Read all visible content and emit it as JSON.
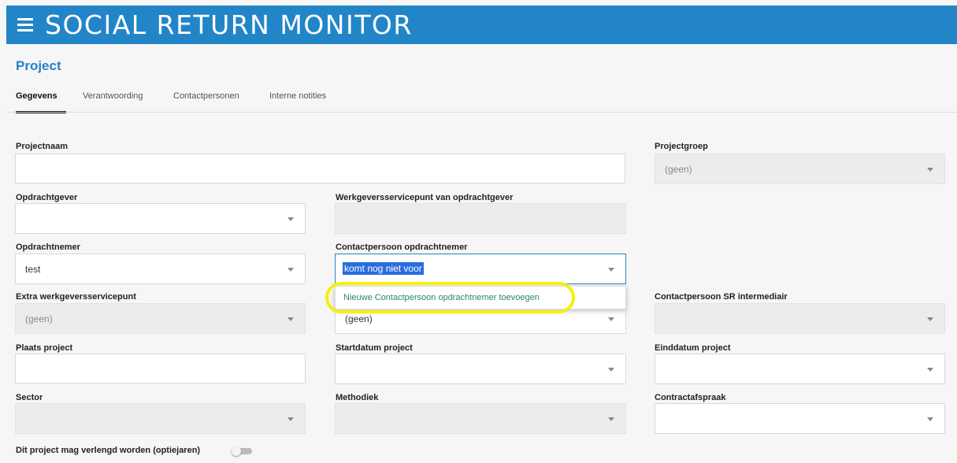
{
  "app": {
    "title": "SOCIAL RETURN MONITOR"
  },
  "page": {
    "title": "Project"
  },
  "tabs": [
    {
      "label": "Gegevens",
      "active": true
    },
    {
      "label": "Verantwoording",
      "active": false
    },
    {
      "label": "Contactpersonen",
      "active": false
    },
    {
      "label": "Interne notities",
      "active": false
    }
  ],
  "form": {
    "projectnaam": {
      "label": "Projectnaam",
      "value": ""
    },
    "projectgroep": {
      "label": "Projectgroep",
      "value": "(geen)"
    },
    "opdrachtgever": {
      "label": "Opdrachtgever",
      "value": ""
    },
    "werkgeversservicepunt_opdrachtgever": {
      "label": "Werkgeversservicepunt van opdrachtgever",
      "value": ""
    },
    "opdrachtnemer": {
      "label": "Opdrachtnemer",
      "value": "test"
    },
    "contactpersoon_opdrachtnemer": {
      "label": "Contactpersoon opdrachtnemer",
      "value": "komt nog niet voor",
      "dropdown_option": "Nieuwe Contactpersoon opdrachtnemer toevoegen"
    },
    "extra_werkgeversservicepunt": {
      "label": "Extra werkgeversservicepunt",
      "value": "(geen)"
    },
    "middle_row4": {
      "value": "(geen)"
    },
    "contactpersoon_sr_intermediair": {
      "label": "Contactpersoon SR intermediair",
      "value": ""
    },
    "plaats_project": {
      "label": "Plaats project",
      "value": ""
    },
    "startdatum_project": {
      "label": "Startdatum project",
      "value": ""
    },
    "einddatum_project": {
      "label": "Einddatum project",
      "value": ""
    },
    "sector": {
      "label": "Sector",
      "value": ""
    },
    "methodiek": {
      "label": "Methodiek",
      "value": ""
    },
    "contractafspraak": {
      "label": "Contractafspraak",
      "value": ""
    },
    "verlengd": {
      "label": "Dit project mag verlengd worden (optiejaren)",
      "checked": false
    }
  },
  "colors": {
    "brand": "#2285c8",
    "highlight": "#f4f00e",
    "option_text": "#2a8a5a"
  }
}
